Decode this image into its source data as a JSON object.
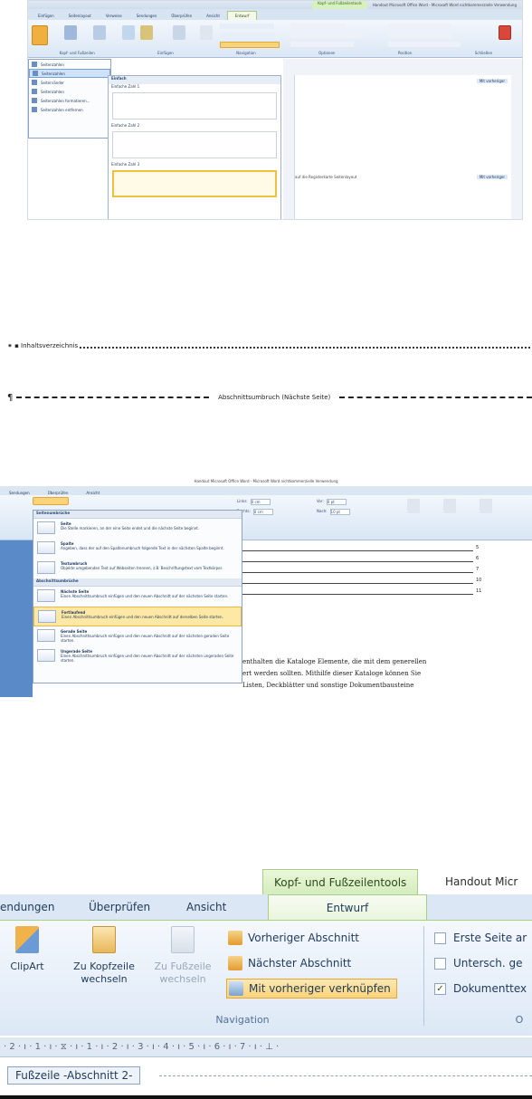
{
  "shot1": {
    "context_tab": "Kopf- und Fußzeilentools",
    "title": "Handout Microsoft Office Word - Microsoft Word nichtkommerzielle Verwendung",
    "tabs": [
      "Einfügen",
      "Seitenlayout",
      "Verweise",
      "Sendungen",
      "Überprüfen",
      "Ansicht",
      "Entwurf"
    ],
    "menu_items": [
      "Seitenzahlen",
      "Seitenzahlen",
      "Seitenränder",
      "Seitenzahlen",
      "Seitenzahlen formatieren...",
      "Seitenzahlen entfernen"
    ],
    "gallery_header": "Einfach",
    "thumbs": [
      "Einfache Zahl 1",
      "Einfache Zahl 2",
      "Einfache Zahl 3"
    ],
    "ribbon_labels": [
      "Kopf- und Fußzeilen",
      "Einfügen",
      "Navigation",
      "Optionen",
      "Position",
      "Schließen"
    ],
    "doc_text": "auf die Registerkarte Seitenlayout",
    "doc_tags": [
      "Mit vorheriger",
      "Mit vorheriger"
    ]
  },
  "shot2": {
    "line1_left": "⁕ ▪ Inhaltsverzeichnis",
    "line2_label": "Abschnittsumbruch (Nächste Seite)",
    "pilcrow": "¶"
  },
  "shot3": {
    "title": "Handout Microsoft Office Word - Microsoft Word nichtkommerzielle Verwendung",
    "tabs": [
      "Sendungen",
      "Überprüfen",
      "Ansicht"
    ],
    "section_pages": "Seitenumbrüche",
    "section_sections": "Abschnittsumbrüche",
    "items": [
      {
        "name": "Seite",
        "desc": "Die Stelle markieren, an der eine Seite endet und die nächste Seite beginnt."
      },
      {
        "name": "Spalte",
        "desc": "Angeben, dass der auf den Spaltenumbruch folgende Text in der nächsten Spalte beginnt."
      },
      {
        "name": "Textumbruch",
        "desc": "Objekte umgebenden Text auf Webseiten trennen, z.B. Beschriftungstext vom Textkörper."
      },
      {
        "name": "Nächste Seite",
        "desc": "Einen Abschnittsumbruch einfügen und den neuen Abschnitt auf der nächsten Seite starten."
      },
      {
        "name": "Fortlaufend",
        "desc": "Einen Abschnittsumbruch einfügen und den neuen Abschnitt auf derselben Seite starten."
      },
      {
        "name": "Gerade Seite",
        "desc": "Einen Abschnittsumbruch einfügen und den neuen Abschnitt auf der nächsten geraden Seite starten."
      },
      {
        "name": "Ungerade Seite",
        "desc": "Einen Abschnittsumbruch einfügen und den neuen Abschnitt auf der nächsten ungeraden Seite starten."
      }
    ],
    "toc_numbers": [
      "5",
      "6",
      "7",
      "10",
      "11"
    ],
    "para_lines": [
      "enthalten die Kataloge Elemente, die mit dem generellen",
      "ert werden sollten. Mithilfe dieser Kataloge können Sie",
      "Listen, Deckblätter und sonstige Dokumentbausteine"
    ],
    "indent_labels": [
      "Links:",
      "Rechts:",
      "Vor:",
      "Nach:"
    ],
    "indent_values": [
      "0 cm",
      "0 cm",
      "0 pt",
      "10 pt"
    ]
  },
  "shot4": {
    "context_tab": "Kopf- und Fußzeilentools",
    "app_title": "Handout Micr",
    "tabs": [
      "endungen",
      "Überprüfen",
      "Ansicht",
      "Entwurf"
    ],
    "clipart": "ClipArt",
    "goto_header": "Zu Kopfzeile wechseln",
    "goto_footer": "Zu Fußzeile wechseln",
    "prev_section": "Vorheriger Abschnitt",
    "next_section": "Nächster Abschnitt",
    "link_prev": "Mit vorheriger verknüpfen",
    "navigation_label": "Navigation",
    "options_label": "O",
    "opt1": "Erste Seite ar",
    "opt2": "Untersch. ge",
    "opt3": "Dokumenttex",
    "opt3_checked": "✓",
    "ruler_text": "· 2 · ı · 1 · ı · ⧖ · ı · 1 · ı · 2 · ı · 3 · ı · 4 · ı · 5 · ı · 6 · ı · 7 · ı · ⊥ ·",
    "footer_tag": "Fußzeile -Abschnitt 2-",
    "colors": {
      "accent_green": "#a8cf84",
      "highlight": "#fbd37a",
      "ribbon_blue": "#dce8f6"
    }
  }
}
